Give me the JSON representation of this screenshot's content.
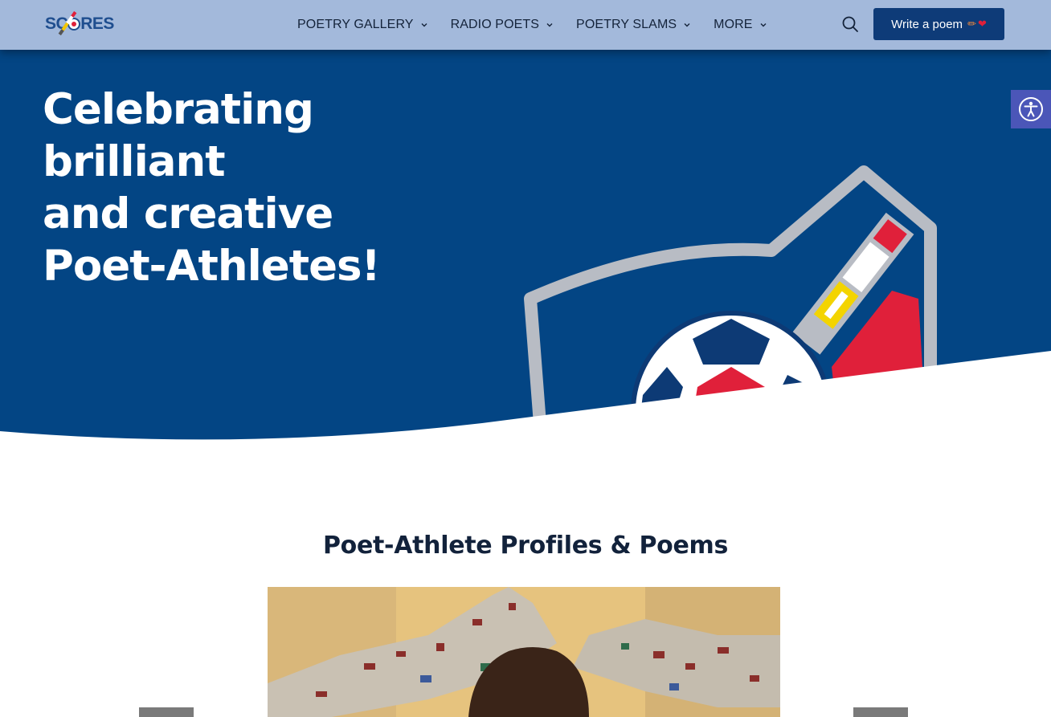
{
  "header": {
    "logo_text_left": "SC",
    "logo_text_right": "RES",
    "nav": [
      {
        "label": "Poetry Gallery",
        "icon": "chevron-down-icon"
      },
      {
        "label": "Radio Poets",
        "icon": "chevron-down-icon"
      },
      {
        "label": "Poetry Slams",
        "icon": "chevron-down-icon"
      },
      {
        "label": "More",
        "icon": "chevron-down-icon"
      }
    ],
    "search_icon": "search-icon",
    "cta": {
      "label": "Write a poem",
      "emoji_pencil": "✏",
      "emoji_heart": "❤"
    }
  },
  "hero": {
    "title_lines": [
      "Celebrating",
      "brilliant",
      "and creative",
      "Poet-Athletes!"
    ]
  },
  "accessibility": {
    "icon": "accessibility-icon"
  },
  "section": {
    "title": "Poet-Athlete Profiles & Poems"
  },
  "colors": {
    "header_bg": "#a3b9db",
    "hero_bg": "#034584",
    "cta_bg": "#0e3b78",
    "brand_red": "#e0203a",
    "brand_yellow": "#f3d400",
    "shield_gray": "#b8bcc4",
    "a11y_bg": "#4b56b8"
  }
}
